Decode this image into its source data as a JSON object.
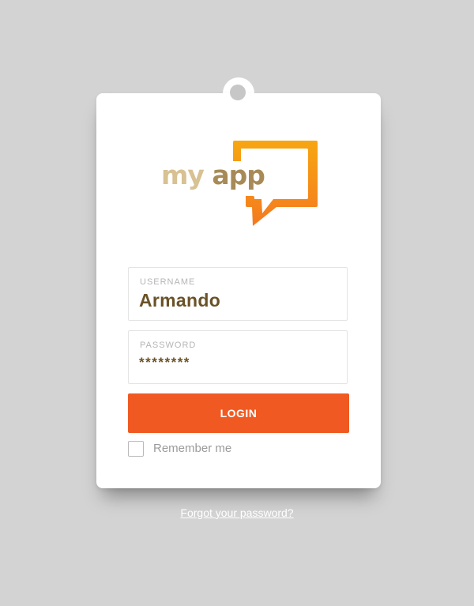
{
  "logo": {
    "my": "my",
    "app": "app",
    "colors": {
      "my": "#d8c192",
      "app": "#a78a56",
      "bubble_top": "#f7a612",
      "bubble_bottom": "#f47a1f"
    }
  },
  "username": {
    "label": "USERNAME",
    "value": "Armando"
  },
  "password": {
    "label": "PASSWORD",
    "value": "********"
  },
  "login": {
    "label": "LOGIN",
    "color": "#f05a22"
  },
  "remember": {
    "label": "Remember me",
    "checked": false
  },
  "forgot": {
    "label": "Forgot your password?"
  }
}
